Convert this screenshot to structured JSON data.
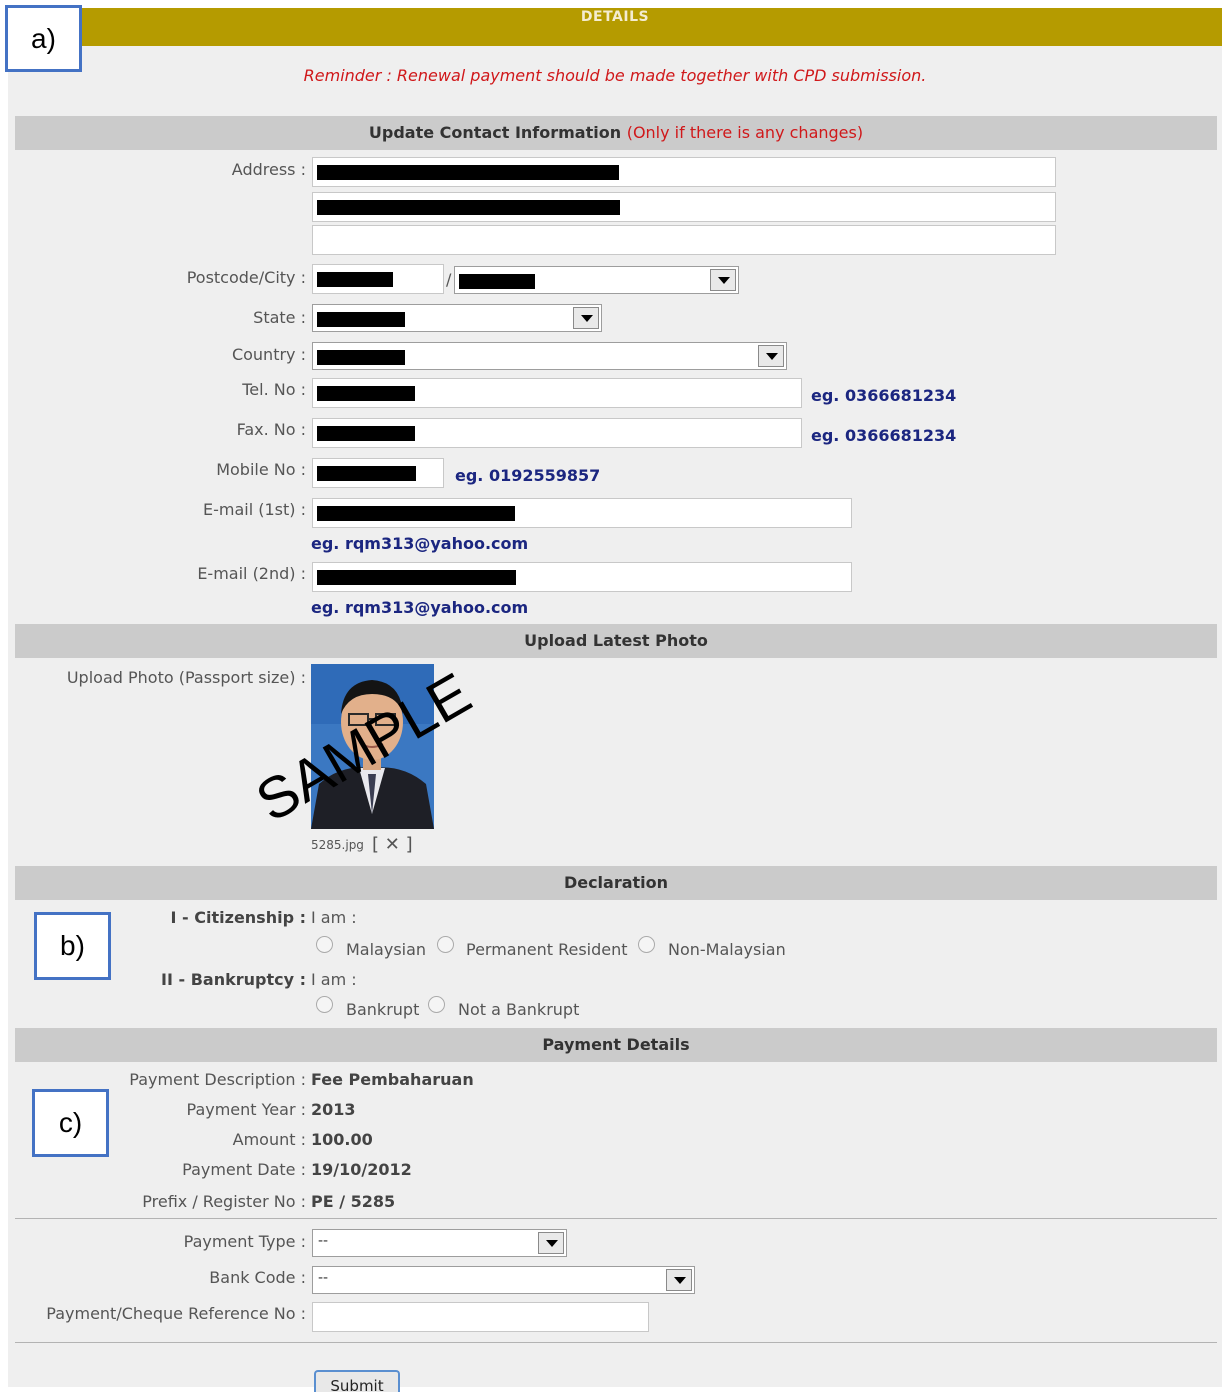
{
  "title": "DETAILS",
  "reminder": "Reminder : Renewal payment should be made together with CPD submission.",
  "callouts": {
    "a": "a)",
    "b": "b)",
    "c": "c)"
  },
  "contact": {
    "heading": "Update Contact Information",
    "heading_note": "(Only if there is any changes)",
    "address_label": "Address :",
    "postcode_label": "Postcode/City :",
    "postcode_sep": "/",
    "state_label": "State :",
    "country_label": "Country :",
    "tel_label": "Tel. No :",
    "tel_hint": "eg. 0366681234",
    "fax_label": "Fax. No :",
    "fax_hint": "eg. 0366681234",
    "mobile_label": "Mobile No :",
    "mobile_hint": "eg. 0192559857",
    "email1_label": "E-mail (1st) :",
    "email1_hint": "eg. rqm313@yahoo.com",
    "email2_label": "E-mail (2nd) :",
    "email2_hint": "eg. rqm313@yahoo.com"
  },
  "photo": {
    "heading": "Upload Latest Photo",
    "label": "Upload Photo (Passport size) :",
    "watermark": "SAMPLE",
    "filename": "5285.jpg",
    "delete_open": "[",
    "delete_icon": "✕",
    "delete_close": "]"
  },
  "declaration": {
    "heading": "Declaration",
    "citizenship_label": "I - Citizenship :",
    "citizenship_prompt": "I am :",
    "citizenship_options": [
      "Malaysian",
      "Permanent Resident",
      "Non-Malaysian"
    ],
    "bankruptcy_label": "II - Bankruptcy :",
    "bankruptcy_prompt": "I am :",
    "bankruptcy_options": [
      "Bankrupt",
      "Not a Bankrupt"
    ]
  },
  "payment": {
    "heading": "Payment Details",
    "description_label": "Payment Description :",
    "description_value": "Fee Pembaharuan",
    "year_label": "Payment Year :",
    "year_value": "2013",
    "amount_label": "Amount :",
    "amount_value": "100.00",
    "date_label": "Payment Date :",
    "date_value": "19/10/2012",
    "register_label": "Prefix / Register No :",
    "register_value": "PE / 5285",
    "type_label": "Payment Type :",
    "type_value": "--",
    "bank_label": "Bank Code :",
    "bank_value": "--",
    "ref_label": "Payment/Cheque Reference No :",
    "ref_value": "",
    "submit_label": "Submit"
  },
  "colors": {
    "title_bar": "#b59b00",
    "reminder": "#d0181a",
    "hint": "#1b2680",
    "section": "#cbcbcb",
    "callout_border": "#4472c4"
  }
}
